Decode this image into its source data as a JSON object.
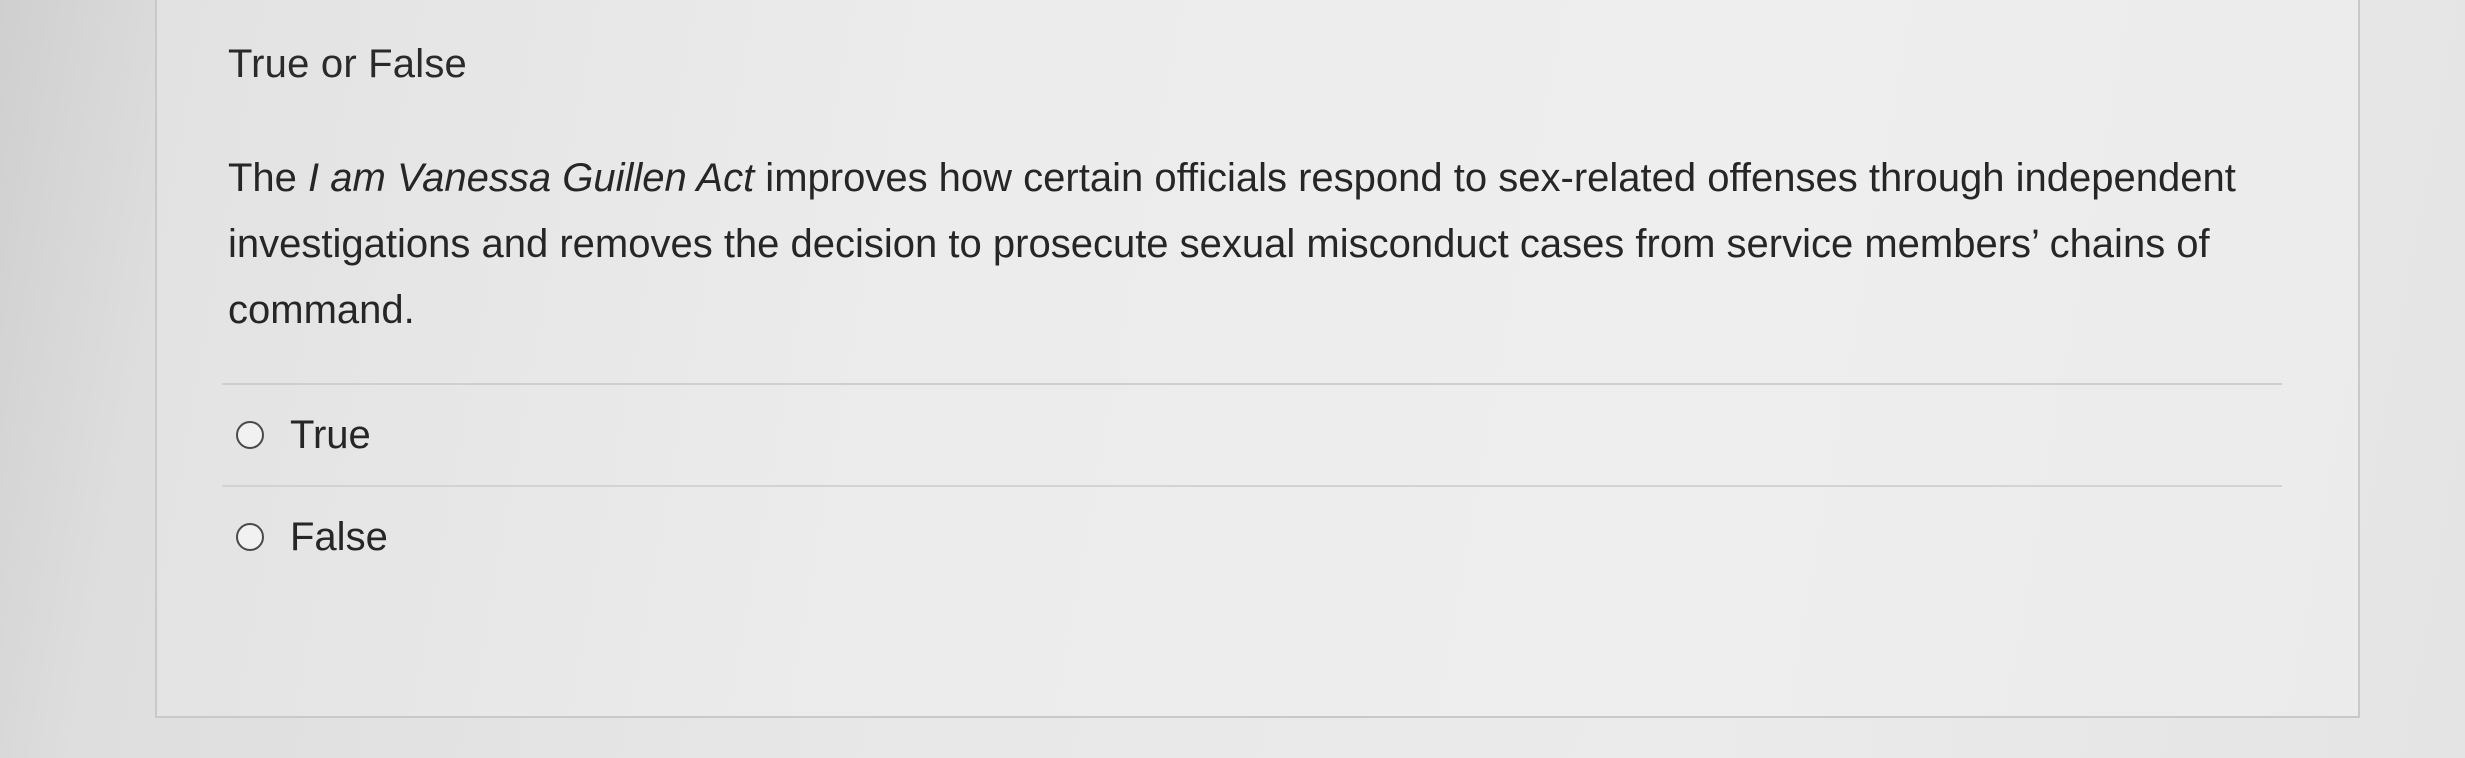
{
  "question": {
    "type_label": "True or False",
    "text_before": "The ",
    "text_italic": "I am Vanessa Guillen Act",
    "text_after": " improves how certain officials respond to sex-related offenses through independent investigations and removes the decision to prosecute sexual misconduct cases from service members’ chains of command."
  },
  "options": [
    {
      "label": "True",
      "selected": false
    },
    {
      "label": "False",
      "selected": false
    }
  ]
}
